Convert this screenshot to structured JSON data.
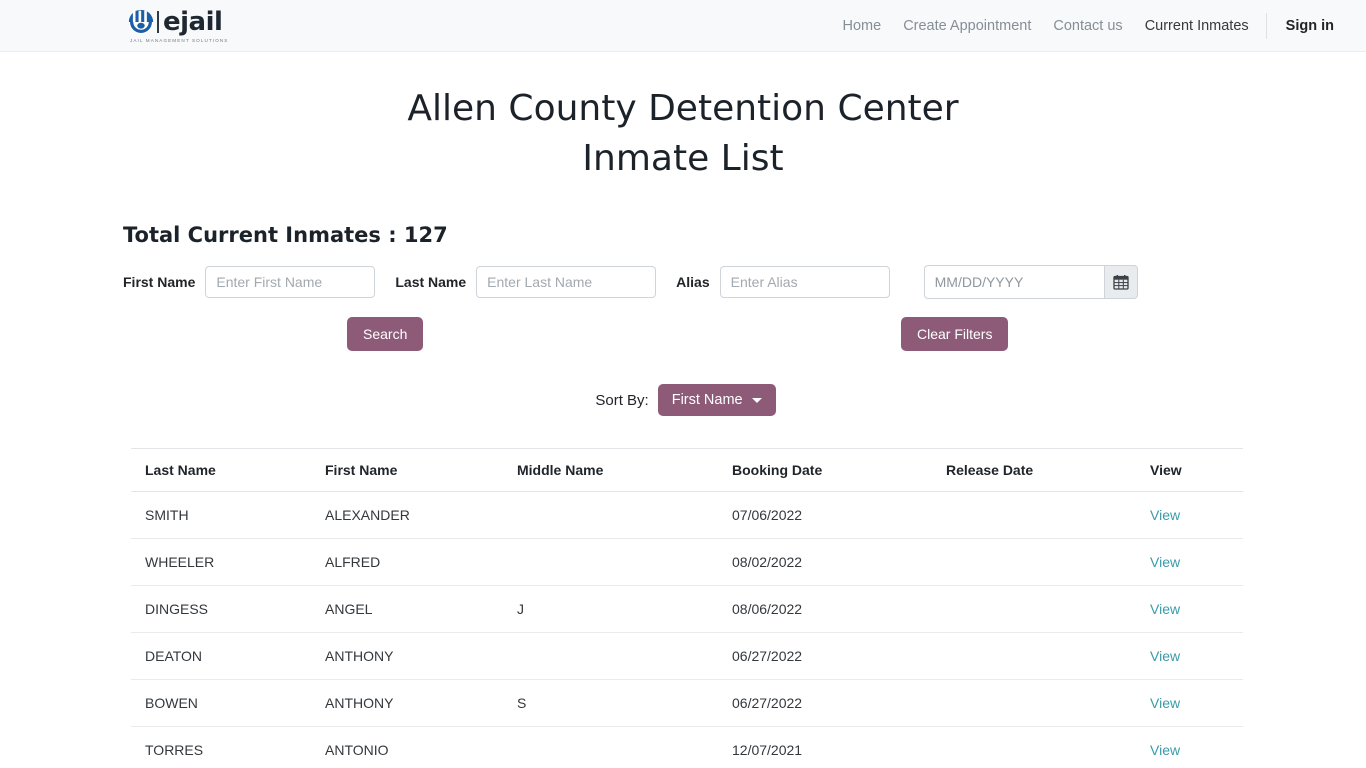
{
  "navbar": {
    "brand": {
      "word": "ejail",
      "tagline": "JAIL MANAGEMENT SOLUTIONS",
      "icon": "ejail-logo-icon"
    },
    "links": [
      {
        "label": "Home",
        "active": false
      },
      {
        "label": "Create Appointment",
        "active": false
      },
      {
        "label": "Contact us",
        "active": false
      },
      {
        "label": "Current Inmates",
        "active": true
      }
    ],
    "signin": "Sign in"
  },
  "page": {
    "title_line1": "Allen County Detention Center",
    "title_line2": "Inmate List",
    "total_label": "Total Current Inmates : 127"
  },
  "filters": {
    "first_name_label": "First Name",
    "first_name_placeholder": "Enter First Name",
    "first_name_value": "",
    "last_name_label": "Last Name",
    "last_name_placeholder": "Enter Last Name",
    "last_name_value": "",
    "alias_label": "Alias",
    "alias_placeholder": "Enter Alias",
    "alias_value": "",
    "date_placeholder": "MM/DD/YYYY",
    "date_value": "",
    "calendar_icon": "calendar-icon",
    "search_button": "Search",
    "clear_button": "Clear Filters",
    "accent_color": "#8d5b78"
  },
  "sort": {
    "label": "Sort By:",
    "selected": "First Name",
    "caret_icon": "chevron-down-icon"
  },
  "table": {
    "headers": [
      "Last Name",
      "First Name",
      "Middle Name",
      "Booking Date",
      "Release Date",
      "View"
    ],
    "view_label": "View",
    "view_link_color": "#3a9ba8",
    "rows": [
      {
        "last": "SMITH",
        "first": "ALEXANDER",
        "middle": "",
        "booking": "07/06/2022",
        "release": "",
        "view": "View"
      },
      {
        "last": "WHEELER",
        "first": "ALFRED",
        "middle": "",
        "booking": "08/02/2022",
        "release": "",
        "view": "View"
      },
      {
        "last": "DINGESS",
        "first": "ANGEL",
        "middle": "J",
        "booking": "08/06/2022",
        "release": "",
        "view": "View"
      },
      {
        "last": "DEATON",
        "first": "ANTHONY",
        "middle": "",
        "booking": "06/27/2022",
        "release": "",
        "view": "View"
      },
      {
        "last": "BOWEN",
        "first": "ANTHONY",
        "middle": "S",
        "booking": "06/27/2022",
        "release": "",
        "view": "View"
      },
      {
        "last": "TORRES",
        "first": "ANTONIO",
        "middle": "",
        "booking": "12/07/2021",
        "release": "",
        "view": "View"
      }
    ]
  }
}
